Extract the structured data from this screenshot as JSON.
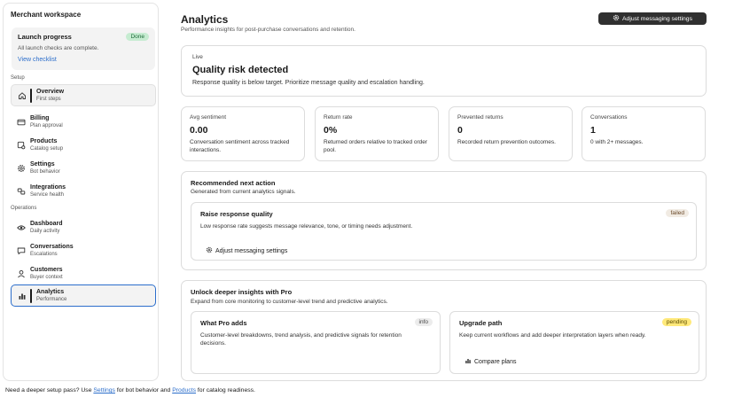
{
  "sidebar": {
    "workspace_title": "Merchant workspace",
    "launch": {
      "title": "Launch progress",
      "badge": "Done",
      "subtitle": "All launch checks are complete.",
      "link": "View checklist"
    },
    "sections": [
      {
        "label": "Setup"
      },
      {
        "label": "Operations"
      }
    ],
    "items": [
      {
        "label": "Overview",
        "sub": "First steps",
        "icon": "home-icon"
      },
      {
        "label": "Billing",
        "sub": "Plan approval",
        "icon": "credit-card-icon"
      },
      {
        "label": "Products",
        "sub": "Catalog setup",
        "icon": "product-tag-icon"
      },
      {
        "label": "Settings",
        "sub": "Bot behavior",
        "icon": "gear-icon"
      },
      {
        "label": "Integrations",
        "sub": "Service health",
        "icon": "plug-icon"
      },
      {
        "label": "Dashboard",
        "sub": "Daily activity",
        "icon": "eye-icon"
      },
      {
        "label": "Conversations",
        "sub": "Escalations",
        "icon": "chat-bubble-icon"
      },
      {
        "label": "Customers",
        "sub": "Buyer context",
        "icon": "person-icon"
      },
      {
        "label": "Analytics",
        "sub": "Performance",
        "icon": "bar-chart-icon"
      }
    ]
  },
  "header": {
    "title": "Analytics",
    "subtitle": "Performance insights for post-purchase conversations and retention.",
    "action_button": "Adjust messaging settings"
  },
  "live": {
    "label": "Live",
    "title": "Quality risk detected",
    "description": "Response quality is below target. Prioritize message quality and escalation handling."
  },
  "metrics": [
    {
      "label": "Avg sentiment",
      "value": "0.00",
      "description": "Conversation sentiment across tracked interactions."
    },
    {
      "label": "Return rate",
      "value": "0%",
      "description": "Returned orders relative to tracked order pool."
    },
    {
      "label": "Prevented returns",
      "value": "0",
      "description": "Recorded return prevention outcomes."
    },
    {
      "label": "Conversations",
      "value": "1",
      "description": "0 with 2+ messages."
    }
  ],
  "recommendation": {
    "title": "Recommended next action",
    "subtitle": "Generated from current analytics signals.",
    "item": {
      "title": "Raise response quality",
      "badge": "failed",
      "description": "Low response rate suggests message relevance, tone, or timing needs adjustment.",
      "button": "Adjust messaging settings"
    }
  },
  "pro": {
    "title": "Unlock deeper insights with Pro",
    "subtitle": "Expand from core monitoring to customer-level trend and predictive analytics.",
    "cards": [
      {
        "title": "What Pro adds",
        "badge": "info",
        "description": "Customer-level breakdowns, trend analysis, and predictive signals for retention decisions."
      },
      {
        "title": "Upgrade path",
        "badge": "pending",
        "description": "Keep current workflows and add deeper interpretation layers when ready.",
        "button": "Compare plans"
      }
    ]
  },
  "footer": {
    "prefix": "Need a deeper setup pass? Use",
    "link1": "Settings",
    "middle": "for bot behavior and",
    "link2": "Products",
    "suffix": "for catalog readiness."
  },
  "colors": {
    "accent": "#2c6ecb",
    "dark_button": "#303030",
    "done_badge": "#c6ecd1",
    "pending_badge": "#ffe97a"
  }
}
